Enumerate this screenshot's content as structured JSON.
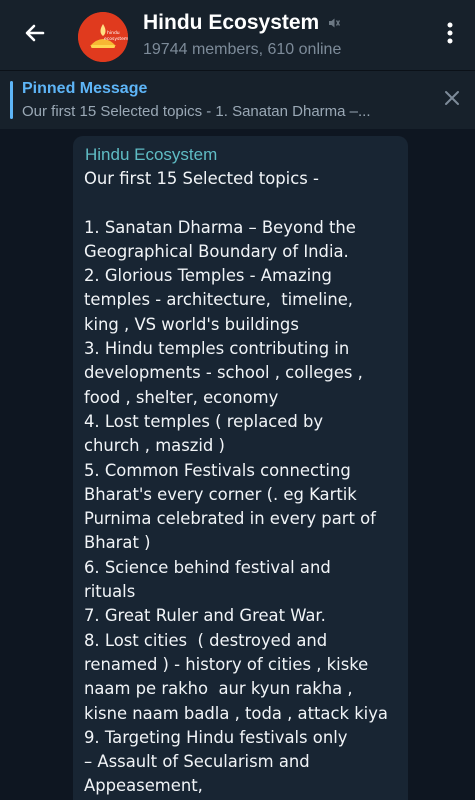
{
  "header": {
    "title": "Hindu Ecosystem",
    "subtitle": "19744 members, 610 online",
    "avatar_text_line1": "hindu",
    "avatar_text_line2": "ecosystem"
  },
  "pinned": {
    "label": "Pinned Message",
    "preview": "Our first 15 Selected topics -  1. Sanatan Dharma –..."
  },
  "message": {
    "sender": "Hindu Ecosystem",
    "lines": [
      "Our first 15 Selected topics -",
      "",
      "1. Sanatan Dharma – Beyond the",
      "Geographical Boundary of India.",
      "2. Glorious Temples - Amazing",
      "temples - architecture,  timeline,",
      "king , VS world's buildings",
      "3. Hindu temples contributing in",
      "developments - school , colleges ,",
      "food , shelter, economy",
      "4. Lost temples ( replaced by",
      "church , maszid )",
      "5. Common Festivals connecting",
      "Bharat's every corner (. eg Kartik",
      "Purnima celebrated in every part of",
      "Bharat )",
      "6. Science behind festival and",
      "rituals",
      "7. Great Ruler and Great War.",
      "8. Lost cities  ( destroyed and",
      "renamed ) - history of cities , kiske",
      "naam pe rakho  aur kyun rakha ,",
      "kisne naam badla , toda , attack kiya",
      "9. Targeting Hindu festivals only",
      "– Assault of Secularism and",
      "Appeasement,"
    ]
  },
  "colors": {
    "background": "#0e1621",
    "header": "#17212b",
    "bubble": "#182533",
    "accent": "#5eb5f7",
    "sender": "#5fbcc4",
    "avatar": "#e03a1e"
  },
  "icons": {
    "back": "arrow-left-icon",
    "mute": "muted-speaker-icon",
    "menu": "vertical-dots-icon",
    "close": "close-icon"
  }
}
